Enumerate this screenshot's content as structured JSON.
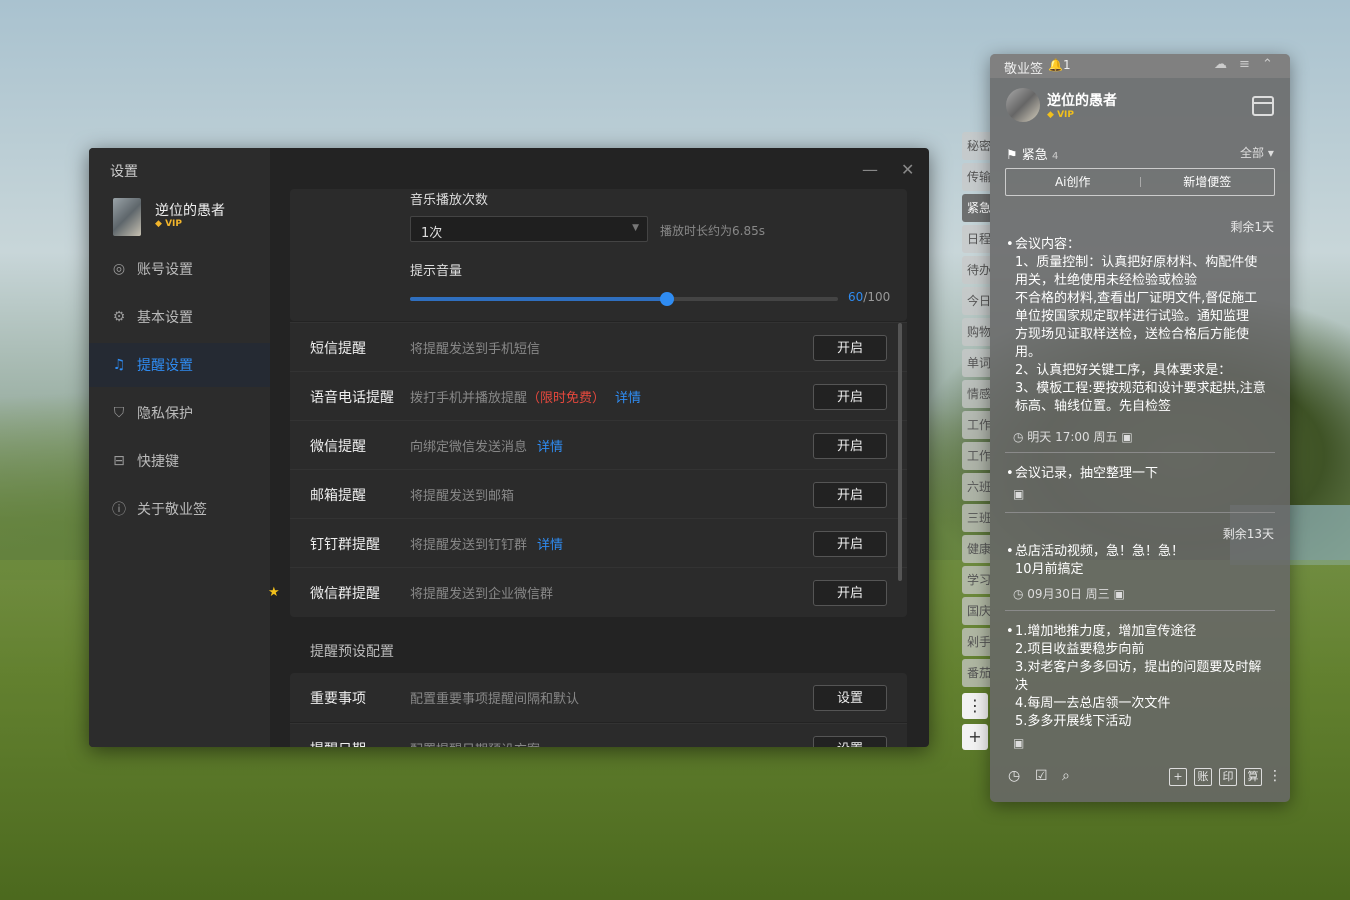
{
  "settings": {
    "title": "设置",
    "user": {
      "name": "逆位的愚者",
      "badge": "VIP"
    },
    "nav": [
      {
        "label": "账号设置",
        "icon": "user-icon"
      },
      {
        "label": "基本设置",
        "icon": "settings-icon"
      },
      {
        "label": "提醒设置",
        "icon": "bell-icon",
        "active": true
      },
      {
        "label": "隐私保护",
        "icon": "shield-icon"
      },
      {
        "label": "快捷键",
        "icon": "keyboard-icon"
      },
      {
        "label": "关于敬业签",
        "icon": "info-icon"
      }
    ],
    "music": {
      "count_label": "音乐播放次数",
      "count_value": "1次",
      "duration_hint": "播放时长约为6.85s",
      "volume_label": "提示音量",
      "volume_value": "60",
      "volume_max": "/100"
    },
    "rows": [
      {
        "label": "短信提醒",
        "desc": "将提醒发送到手机短信",
        "button": "开启"
      },
      {
        "label": "语音电话提醒",
        "desc": "拨打手机并播放提醒",
        "highlight": "（限时免费）",
        "link": "详情",
        "button": "开启"
      },
      {
        "label": "微信提醒",
        "desc": "向绑定微信发送消息",
        "link": "详情",
        "button": "开启"
      },
      {
        "label": "邮箱提醒",
        "desc": "将提醒发送到邮箱",
        "button": "开启"
      },
      {
        "label": "钉钉群提醒",
        "desc": "将提醒发送到钉钉群",
        "link": "详情",
        "button": "开启"
      },
      {
        "label": "微信群提醒",
        "desc": "将提醒发送到企业微信群",
        "button": "开启"
      }
    ],
    "preset_section": "提醒预设配置",
    "presets": [
      {
        "label": "重要事项",
        "desc": "配置重要事项提醒间隔和默认",
        "button": "设置"
      },
      {
        "label": "提醒日期",
        "desc": "配置提醒日期预设方案",
        "button": "设置"
      }
    ]
  },
  "note": {
    "app_name": "敬业签",
    "bell_count": "1",
    "user": {
      "name": "逆位的愚者",
      "badge": "VIP"
    },
    "category": "紧急",
    "category_count": "4",
    "filter": "全部",
    "ai_button": "Ai创作",
    "new_button": "新增便签",
    "side_tabs": [
      "秘密",
      "传输",
      "紧急",
      "日程",
      "待办",
      "今日",
      "购物",
      "单词",
      "情感",
      "工作",
      "工作",
      "六班",
      "三班",
      "健康",
      "学习",
      "国庆",
      "剁手",
      "番茄"
    ],
    "items": [
      {
        "remain": "剩余1天",
        "lines": [
          "会议内容：",
          "1、质量控制：认真把好原材料、构配件使",
          "用关，杜绝使用未经检验或检验",
          "不合格的材料,查看出厂证明文件,督促施工",
          "单位按国家规定取样进行试验。通知监理",
          "方现场见证取样送检，送检合格后方能使",
          "用。",
          "2、认真把好关键工序，具体要求是：",
          "3、模板工程:要按规范和设计要求起拱,注意",
          "标高、轴线位置。先自检签"
        ],
        "meta": "明天 17:00 周五"
      },
      {
        "remain": "",
        "lines": [
          "会议记录，抽空整理一下"
        ],
        "meta": ""
      },
      {
        "remain": "剩余13天",
        "lines": [
          "总店活动视频，急！急！急！",
          "10月前搞定"
        ],
        "meta": "09月30日 周三"
      },
      {
        "remain": "",
        "lines": [
          "1.增加地推力度，增加宣传途径",
          "2.项目收益要稳步向前",
          "3.对老客户多多回访，提出的问题要及时解",
          "决",
          "4.每周一去总店领一次文件",
          "5.多多开展线下活动"
        ],
        "meta": ""
      }
    ],
    "footer_buttons": [
      "账",
      "印",
      "算"
    ]
  }
}
